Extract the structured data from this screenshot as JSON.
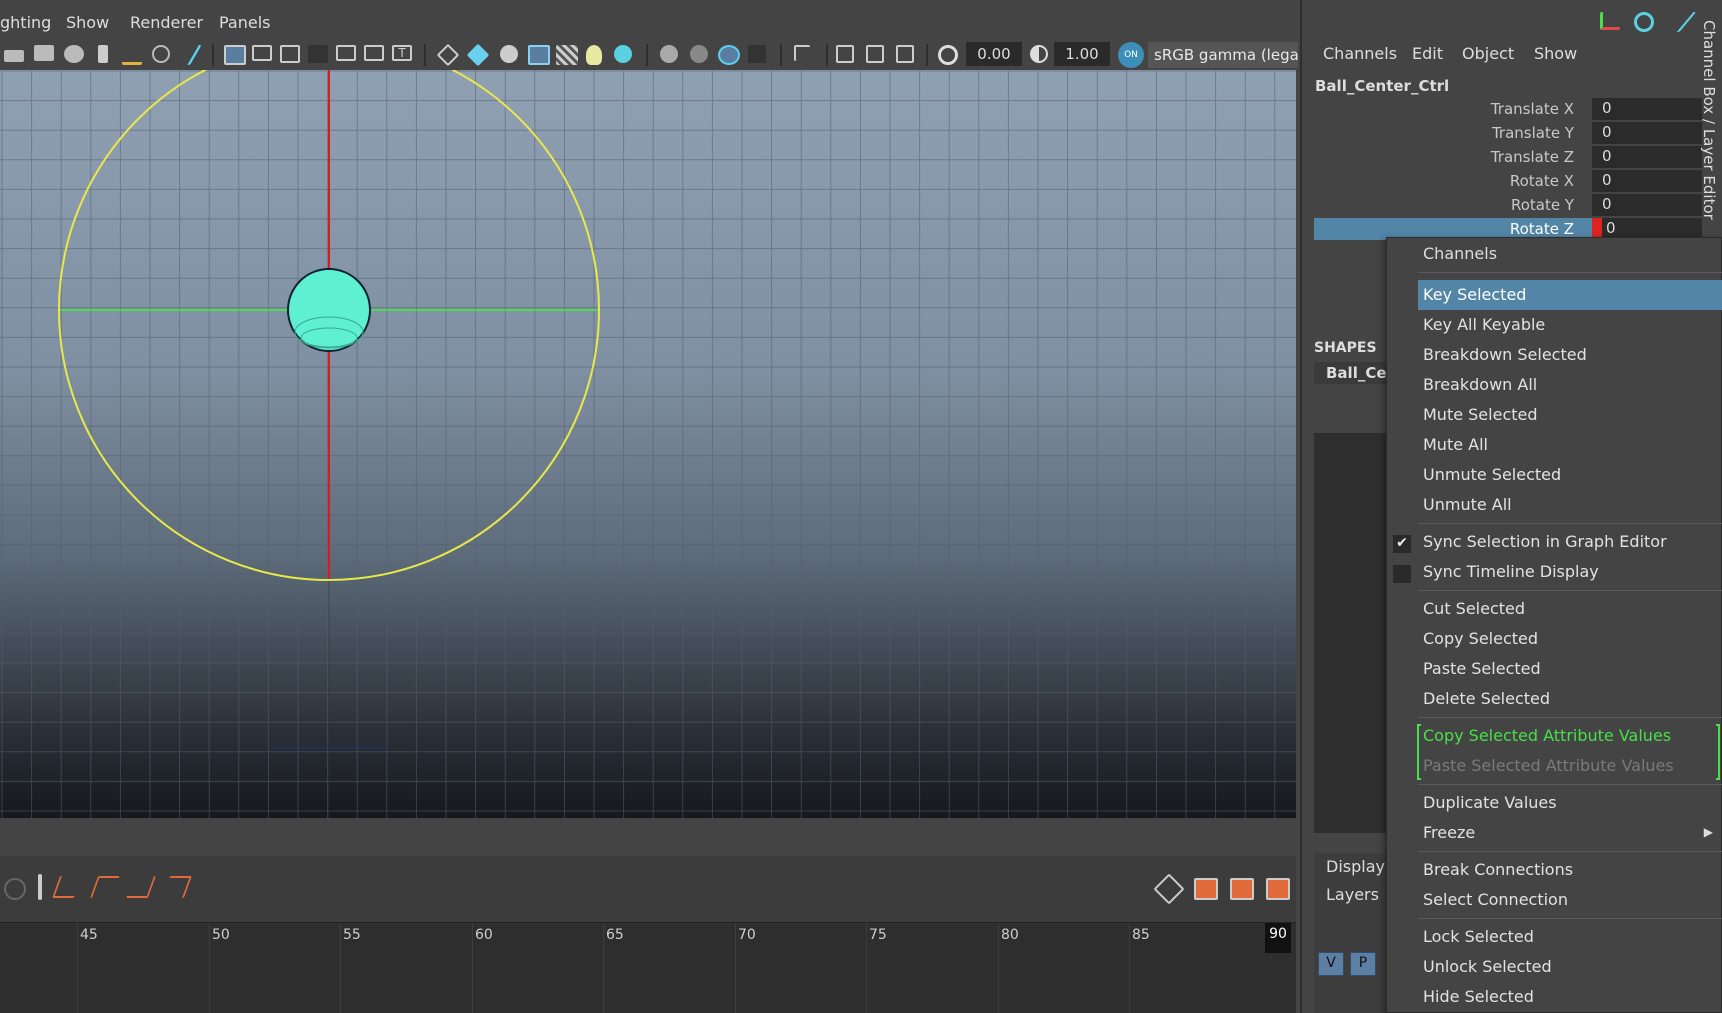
{
  "menubar": {
    "items": [
      "ghting",
      "Show",
      "Renderer",
      "Panels"
    ]
  },
  "toolbar": {
    "exposure_value": "0.00",
    "gamma_value": "1.00",
    "on_label": "ON",
    "colorspace": "sRGB gamma (legacy"
  },
  "timeline": {
    "ticks": [
      "45",
      "50",
      "55",
      "60",
      "65",
      "70",
      "75",
      "80",
      "85"
    ],
    "current_frame": "90"
  },
  "channel_box": {
    "menus": [
      "Channels",
      "Edit",
      "Object",
      "Show"
    ],
    "object_name": "Ball_Center_Ctrl",
    "attributes": [
      {
        "label": "Translate X",
        "value": "0"
      },
      {
        "label": "Translate Y",
        "value": "0"
      },
      {
        "label": "Translate Z",
        "value": "0"
      },
      {
        "label": "Rotate X",
        "value": "0"
      },
      {
        "label": "Rotate Y",
        "value": "0"
      },
      {
        "label": "Rotate Z",
        "value": "0"
      }
    ],
    "shapes_header": "SHAPES",
    "shapes_item": "Ball_Center_Ctrl",
    "display_tab": "Display",
    "layers_tab": "Layers",
    "v_button": "V",
    "p_button": "P",
    "vertical_title": "Channel Box / Layer Editor"
  },
  "context_menu": {
    "title": "Channels",
    "key_selected": "Key Selected",
    "key_all_keyable": "Key All Keyable",
    "breakdown_selected": "Breakdown Selected",
    "breakdown_all": "Breakdown All",
    "mute_selected": "Mute Selected",
    "mute_all": "Mute All",
    "unmute_selected": "Unmute Selected",
    "unmute_all": "Unmute All",
    "sync_selection": "Sync Selection in Graph Editor",
    "sync_timeline": "Sync Timeline Display",
    "cut_selected": "Cut Selected",
    "copy_selected": "Copy Selected",
    "paste_selected": "Paste Selected",
    "delete_selected": "Delete Selected",
    "copy_attr_values": "Copy Selected Attribute Values",
    "paste_attr_values": "Paste Selected Attribute Values",
    "duplicate_values": "Duplicate Values",
    "freeze": "Freeze",
    "break_connections": "Break Connections",
    "select_connection": "Select Connection",
    "lock_selected": "Lock Selected",
    "unlock_selected": "Unlock Selected",
    "hide_selected": "Hide Selected"
  },
  "colors": {
    "highlight": "#5285a6",
    "accent_green": "#48e048",
    "control_curve": "#e8e84a",
    "ball": "#5ef0d0"
  }
}
